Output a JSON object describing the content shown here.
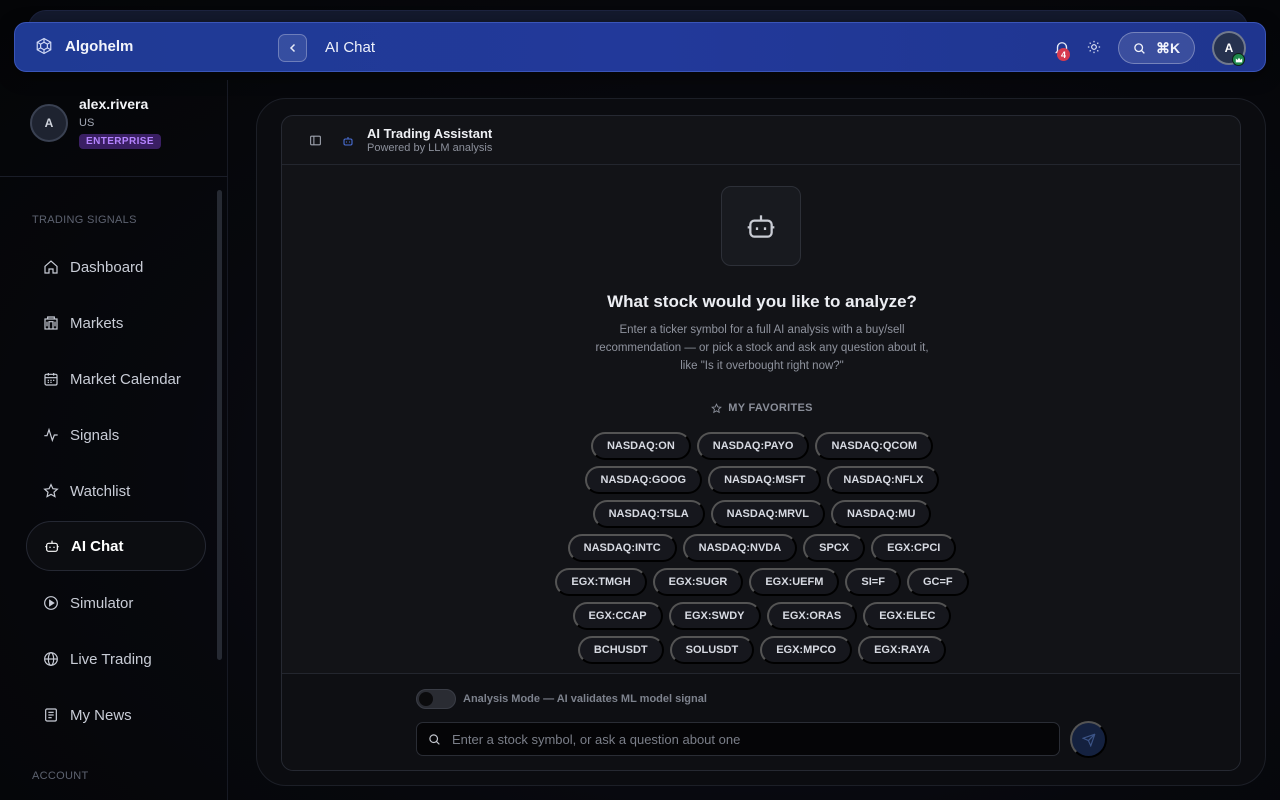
{
  "app": {
    "brand_name": "Algohelm",
    "page_title": "AI Chat"
  },
  "topbar": {
    "notification_count": "4",
    "search_shortcut": "⌘K",
    "avatar_initial": "A"
  },
  "user": {
    "avatar_initial": "A",
    "name": "alex.rivera",
    "country": "US",
    "tier": "ENTERPRISE"
  },
  "sidebar": {
    "section_trading": "TRADING SIGNALS",
    "section_account": "ACCOUNT",
    "items": [
      {
        "label": "Dashboard",
        "icon": "home-icon"
      },
      {
        "label": "Markets",
        "icon": "building-icon"
      },
      {
        "label": "Market Calendar",
        "icon": "calendar-icon"
      },
      {
        "label": "Signals",
        "icon": "activity-icon"
      },
      {
        "label": "Watchlist",
        "icon": "star-icon"
      },
      {
        "label": "AI Chat",
        "icon": "bot-icon",
        "active": true
      },
      {
        "label": "Simulator",
        "icon": "play-circle-icon"
      },
      {
        "label": "Live Trading",
        "icon": "globe-icon"
      },
      {
        "label": "My News",
        "icon": "newspaper-icon"
      }
    ]
  },
  "chat": {
    "assistant_title": "AI Trading Assistant",
    "assistant_subtitle": "Powered by LLM analysis",
    "hero_title": "What stock would you like to analyze?",
    "hero_description": "Enter a ticker symbol for a full AI analysis with a buy/sell recommendation — or pick a stock and ask any question about it, like \"Is it overbought right now?\"",
    "favorites_label": "MY FAVORITES",
    "favorites": [
      [
        "NASDAQ:ON",
        "NASDAQ:PAYO",
        "NASDAQ:QCOM"
      ],
      [
        "NASDAQ:GOOG",
        "NASDAQ:MSFT",
        "NASDAQ:NFLX"
      ],
      [
        "NASDAQ:TSLA",
        "NASDAQ:MRVL",
        "NASDAQ:MU"
      ],
      [
        "NASDAQ:INTC",
        "NASDAQ:NVDA",
        "SPCX",
        "EGX:CPCI"
      ],
      [
        "EGX:TMGH",
        "EGX:SUGR",
        "EGX:UEFM",
        "SI=F",
        "GC=F"
      ],
      [
        "EGX:CCAP",
        "EGX:SWDY",
        "EGX:ORAS",
        "EGX:ELEC"
      ],
      [
        "BCHUSDT",
        "SOLUSDT",
        "EGX:MPCO",
        "EGX:RAYA"
      ]
    ],
    "analysis_mode_label": "Analysis Mode — AI validates ML model signal",
    "analysis_mode_on": false,
    "input_placeholder": "Enter a stock symbol, or ask a question about one",
    "input_value": ""
  },
  "colors": {
    "topbar_bg": "#22399a",
    "tier_badge_bg": "#3a1f63",
    "tier_badge_text": "#b583ff",
    "notification_badge": "#d63a4f",
    "send_button_bg": "#14213f"
  }
}
